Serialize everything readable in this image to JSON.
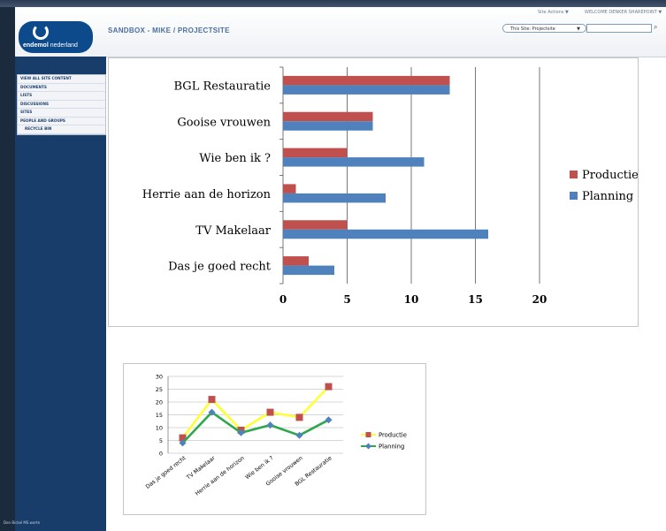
{
  "header": {
    "logo_text_1": "endemol",
    "logo_text_2": "nederland",
    "site_title": "SANDBOX - MIKE / PROJECTSITE",
    "site_actions": "Site Actions ▼",
    "welcome": "WELCOME DENKER SHAREPOINT ▼",
    "search_scope": "This Site: Projectsite"
  },
  "sidebar": {
    "items": [
      {
        "label": "VIEW ALL SITE CONTENT"
      },
      {
        "label": "DOCUMENTS"
      },
      {
        "label": "LISTS"
      },
      {
        "label": "DISCUSSIONS"
      },
      {
        "label": "SITES"
      },
      {
        "label": "PEOPLE AND GROUPS"
      },
      {
        "label": "RECYCLE BIN"
      }
    ],
    "footer": "Den Bickel MS worte"
  },
  "colors": {
    "productie_bar": "#c0504d",
    "planning_bar": "#4f81bd",
    "productie_line": "#ffff33",
    "productie_marker": "#c0504d",
    "planning_line": "#2ea84d",
    "planning_marker": "#4f81bd",
    "sidebar": "#183d6b"
  },
  "chart_data": [
    {
      "type": "bar",
      "orientation": "horizontal",
      "categories": [
        "BGL Restauratie",
        "Gooise vrouwen",
        "Wie ben ik ?",
        "Herrie aan de horizon",
        "TV Makelaar",
        "Das je goed recht"
      ],
      "series": [
        {
          "name": "Productie",
          "values": [
            13,
            7,
            5,
            1,
            5,
            2
          ]
        },
        {
          "name": "Planning",
          "values": [
            13,
            7,
            11,
            8,
            16,
            4
          ]
        }
      ],
      "xlim": [
        0,
        20
      ],
      "xticks": [
        "0",
        "5",
        "10",
        "15",
        "20"
      ],
      "grid": true,
      "legend": "right"
    },
    {
      "type": "line",
      "categories": [
        "Das je goed recht",
        "TV Makelaar",
        "Herrie aan de horizon",
        "Wie ben ik ?",
        "Gooise vrouwen",
        "BGL Restauratie"
      ],
      "series": [
        {
          "name": "Productie",
          "values": [
            6,
            21,
            9,
            16,
            14,
            26
          ]
        },
        {
          "name": "Planning",
          "values": [
            4,
            16,
            8,
            11,
            7,
            13
          ]
        }
      ],
      "ylim": [
        0,
        30
      ],
      "yticks": [
        "0",
        "5",
        "10",
        "15",
        "20",
        "25",
        "30"
      ],
      "grid": true,
      "legend": "right"
    }
  ]
}
